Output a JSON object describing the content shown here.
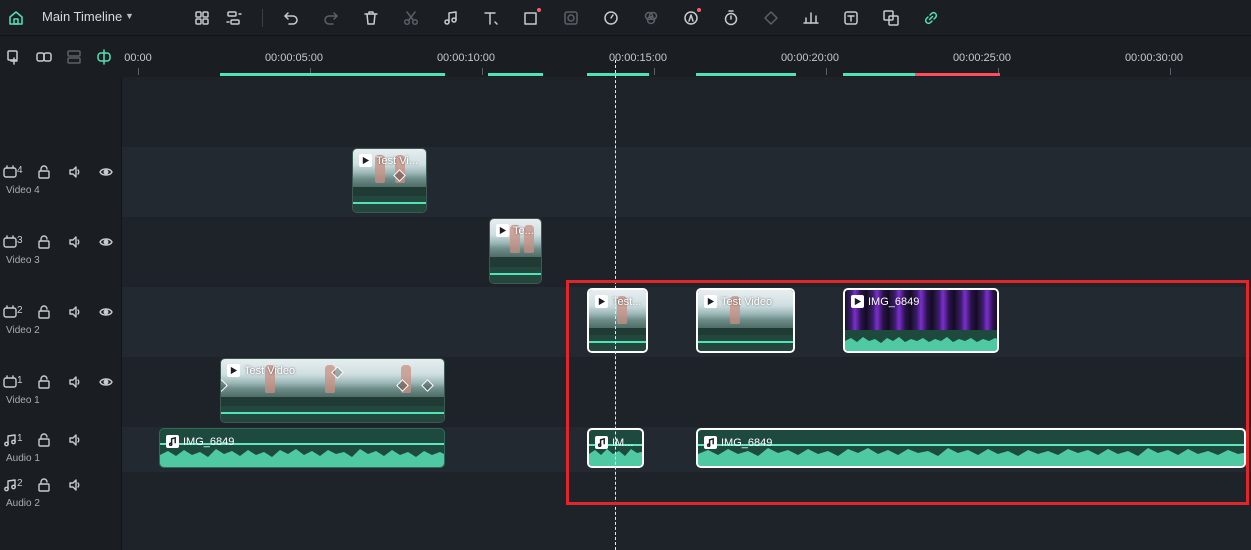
{
  "toolbar": {
    "title": "Main Timeline",
    "icons": [
      "home-icon",
      "grid-icon",
      "auto-layout-icon",
      "undo-icon",
      "redo-icon",
      "delete-icon",
      "cut-icon",
      "audio-edit-icon",
      "text-icon",
      "crop-icon",
      "mask-icon",
      "speed-icon",
      "color-icon",
      "ai-icon",
      "timer-icon",
      "keyframe-icon",
      "audio-mix-icon",
      "speech-to-text-icon",
      "translate-icon",
      "link-icon"
    ]
  },
  "ruler": {
    "labels": [
      "00:00",
      "00:00:05:00",
      "00:00:10:00",
      "00:00:15:00",
      "00:00:20:00",
      "00:00:25:00",
      "00:00:30:00"
    ]
  },
  "tracks": [
    {
      "num": "4",
      "name": "Video 4",
      "kind": "video"
    },
    {
      "num": "3",
      "name": "Video 3",
      "kind": "video"
    },
    {
      "num": "2",
      "name": "Video 2",
      "kind": "video"
    },
    {
      "num": "1",
      "name": "Video 1",
      "kind": "video"
    },
    {
      "num": "1",
      "name": "Audio 1",
      "kind": "audio"
    },
    {
      "num": "2",
      "name": "Audio 2",
      "kind": "audio"
    }
  ],
  "clips": {
    "v4": "Test Vi...",
    "v3": "Te...",
    "v2a": "Test...",
    "v2b": "Test Video",
    "v2c": "IMG_6849",
    "v1": "Test Video",
    "a1a": "IMG_6849",
    "a1b": "IM...",
    "a1c": "IMG_6849"
  },
  "colors": {
    "accent": "#4fe3b5",
    "selection": "#ffffff",
    "highlight": "#e0262b",
    "marker_red": "#ff4d5e"
  }
}
